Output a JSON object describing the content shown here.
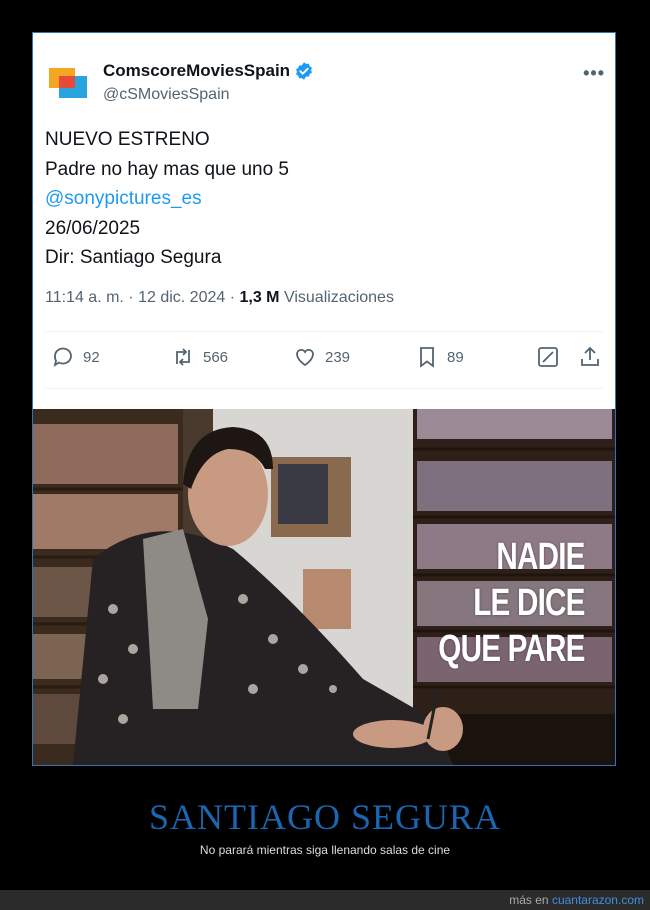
{
  "tweet": {
    "display_name": "ComscoreMoviesSpain",
    "handle": "@cSMoviesSpain",
    "lines": [
      "NUEVO ESTRENO",
      "Padre no hay mas que uno 5",
      "@sonypictures_es",
      "26/06/2025",
      "Dir: Santiago Segura"
    ],
    "time": "11:14 a. m.",
    "date": "12 dic. 2024",
    "views_count": "1,3 M",
    "views_label": "Visualizaciones",
    "replies": "92",
    "retweets": "566",
    "likes": "239",
    "bookmarks": "89",
    "colors": {
      "link": "#1d9bf0",
      "verified": "#1d9bf0"
    }
  },
  "image": {
    "overlay_lines": [
      "NADIE",
      "LE DICE",
      "QUE PARE"
    ]
  },
  "caption": {
    "title": "SANTIAGO SEGURA",
    "subtitle": "No parará mientras siga llenando salas de cine",
    "title_color": "#1a66b0"
  },
  "footer": {
    "prefix": "más en",
    "site": "cuantarazon.com"
  }
}
